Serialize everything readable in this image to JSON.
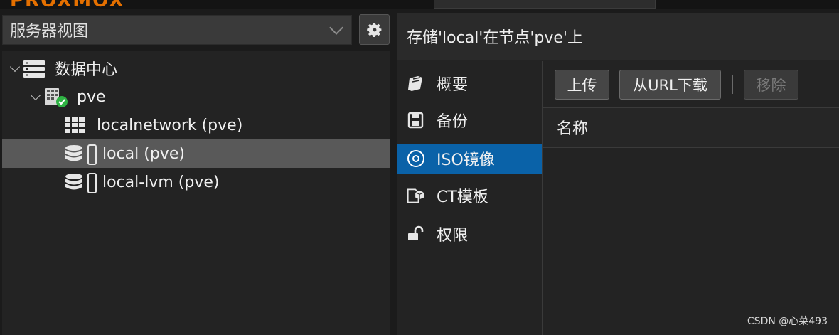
{
  "header": {
    "logo_text": "PROXMOX"
  },
  "view_selector": {
    "selected": "服务器视图"
  },
  "tree": {
    "items": [
      {
        "label": "数据中心",
        "icon": "datacenter-icon"
      },
      {
        "label": "pve",
        "icon": "server-online-icon"
      },
      {
        "label": "localnetwork (pve)",
        "icon": "sdn-grid-icon"
      },
      {
        "label": "local (pve)",
        "icon": "storage-icon",
        "selected": true
      },
      {
        "label": "local-lvm (pve)",
        "icon": "storage-icon"
      }
    ]
  },
  "content": {
    "title": "存储'local'在节点'pve'上",
    "nav": [
      {
        "label": "概要",
        "icon": "book-icon"
      },
      {
        "label": "备份",
        "icon": "floppy-icon"
      },
      {
        "label": "ISO镜像",
        "icon": "disc-icon",
        "active": true
      },
      {
        "label": "CT模板",
        "icon": "template-icon"
      },
      {
        "label": "权限",
        "icon": "unlock-icon"
      }
    ],
    "toolbar": {
      "upload": "上传",
      "download_url": "从URL下载",
      "remove": "移除"
    },
    "grid": {
      "columns": [
        "名称"
      ]
    }
  },
  "watermark": "CSDN @心菜493",
  "colors": {
    "accent": "#0a62a8",
    "brand": "#e57000",
    "status_ok": "#2fb344"
  }
}
